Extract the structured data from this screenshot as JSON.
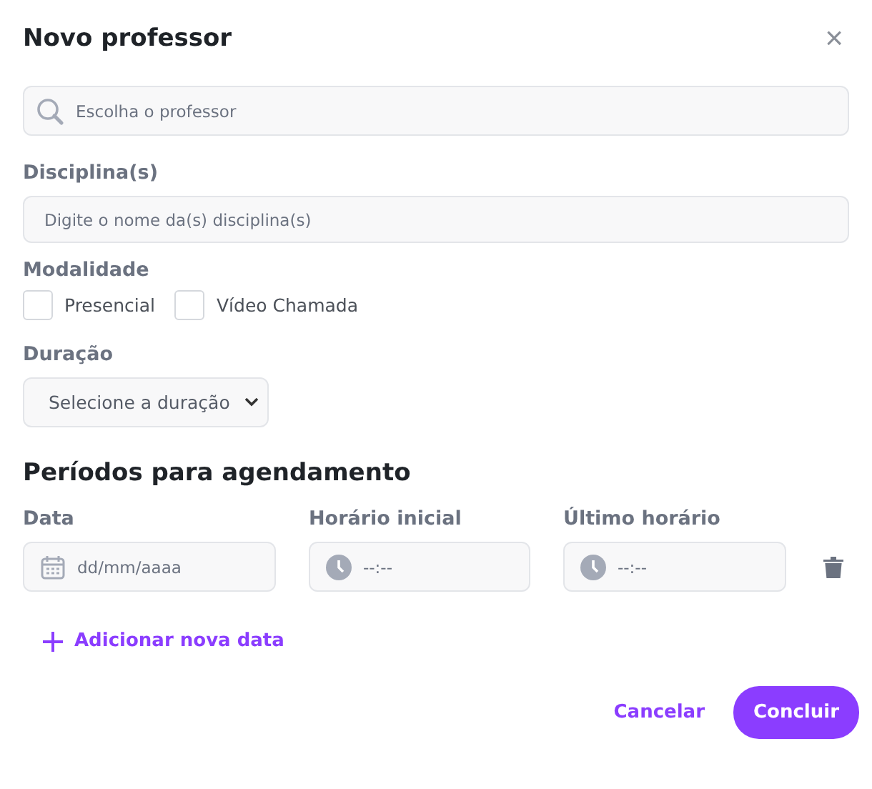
{
  "dialog": {
    "title": "Novo professor",
    "close": "×"
  },
  "teacher_search": {
    "placeholder": "Escolha o professor"
  },
  "subjects": {
    "label": "Disciplina(s)",
    "placeholder": "Digite o nome da(s) disciplina(s)"
  },
  "modality": {
    "label": "Modalidade",
    "options": [
      {
        "label": "Presencial",
        "checked": false
      },
      {
        "label": "Vídeo Chamada",
        "checked": false
      }
    ]
  },
  "duration": {
    "label": "Duração",
    "placeholder": "Selecione a duração"
  },
  "periods": {
    "title": "Períodos para agendamento",
    "columns": [
      {
        "label": "Data",
        "kind": "date",
        "placeholder": "dd/mm/aaaa"
      },
      {
        "label": "Horário inicial",
        "kind": "time",
        "placeholder": "--:--"
      },
      {
        "label": "Último horário",
        "kind": "time",
        "placeholder": "--:--"
      }
    ],
    "add_link": "Adicionar nova data"
  },
  "buttons": [
    {
      "label": "Cancelar",
      "kind": "text"
    },
    {
      "label": "Concluir",
      "kind": "primary"
    }
  ]
}
